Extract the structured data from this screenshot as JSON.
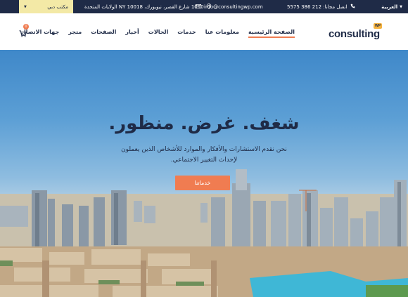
{
  "topbar": {
    "language": "العربية",
    "phone": "اتصل مجانا: 212 386 5575",
    "email": "info@consultingwp.com",
    "address": "1010 شارع القصر، نيويورك، NY 10018 الولايات المتحدة",
    "office": "مكتب دبي"
  },
  "brand": {
    "name": "consulting",
    "badge": "WP"
  },
  "nav": {
    "items": [
      {
        "label": "الصفحة الرئيسية",
        "active": true
      },
      {
        "label": "معلومات عنا"
      },
      {
        "label": "خدمات"
      },
      {
        "label": "الحالات"
      },
      {
        "label": "أخبار"
      },
      {
        "label": "الصفحات"
      },
      {
        "label": "متجر"
      },
      {
        "label": "جهات الاتصال"
      }
    ],
    "cart_count": "0"
  },
  "hero": {
    "headline": "شغف. غرض. منظور.",
    "subtitle": "نحن نقدم الاستشارات والأفكار والموارد للأشخاص الذين يعملون لإحداث التغيير الاجتماعي.",
    "cta": "خدماتنا"
  },
  "colors": {
    "topbar": "#1f2b47",
    "accent": "#f07c51",
    "office_bg": "#f3e9a6",
    "logo_badge": "#f4b23f"
  },
  "icons": {
    "phone": "phone-icon",
    "email": "envelope-icon",
    "address": "map-pin-icon",
    "cart": "cart-icon",
    "caret": "chevron-down-icon"
  }
}
